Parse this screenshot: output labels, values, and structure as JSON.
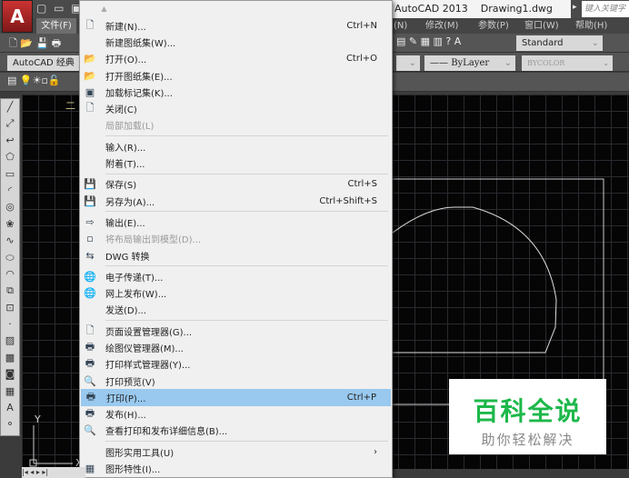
{
  "titlebar": {
    "app_logo": "A",
    "quick_access": "▢ ▭ ▣",
    "title": "AutoCAD 2013",
    "document": "Drawing1.dwg",
    "search_placeholder": "键入关键字"
  },
  "menubar": {
    "file": "文件(F)",
    "partial": "(N)",
    "modify": "修改(M)",
    "params": "参数(P)",
    "window": "窗口(W)",
    "help": "帮助(H)"
  },
  "toolbar": {
    "workspace": "AutoCAD 经典",
    "text_style": "Standard",
    "linetype": "ByLayer",
    "plotstyle": "BYCOLOR",
    "annotation": "二"
  },
  "file_menu": {
    "groups": [
      [
        {
          "icon": "new-icon",
          "glyph": "🗋",
          "label": "新建(N)...",
          "shortcut": "Ctrl+N"
        },
        {
          "icon": "",
          "glyph": "",
          "label": "新建图纸集(W)...",
          "shortcut": ""
        },
        {
          "icon": "open-icon",
          "glyph": "📂",
          "label": "打开(O)...",
          "shortcut": "Ctrl+O"
        },
        {
          "icon": "open-sheetset-icon",
          "glyph": "📂",
          "label": "打开图纸集(E)...",
          "shortcut": ""
        },
        {
          "icon": "markup-icon",
          "glyph": "▣",
          "label": "加载标记集(K)...",
          "shortcut": ""
        },
        {
          "icon": "close-icon",
          "glyph": "🗋",
          "label": "关闭(C)",
          "shortcut": ""
        },
        {
          "icon": "",
          "glyph": "",
          "label": "局部加载(L)",
          "shortcut": "",
          "disabled": true
        }
      ],
      [
        {
          "icon": "",
          "glyph": "",
          "label": "输入(R)...",
          "shortcut": ""
        },
        {
          "icon": "",
          "glyph": "",
          "label": "附着(T)...",
          "shortcut": ""
        }
      ],
      [
        {
          "icon": "save-icon",
          "glyph": "💾",
          "label": "保存(S)",
          "shortcut": "Ctrl+S"
        },
        {
          "icon": "save-as-icon",
          "glyph": "💾",
          "label": "另存为(A)...",
          "shortcut": "Ctrl+Shift+S"
        }
      ],
      [
        {
          "icon": "export-icon",
          "glyph": "⇨",
          "label": "输出(E)...",
          "shortcut": ""
        },
        {
          "icon": "export-layout-icon",
          "glyph": "▫",
          "label": "将布局输出到模型(D)...",
          "shortcut": "",
          "disabled": true
        },
        {
          "icon": "dwg-convert-icon",
          "glyph": "⇆",
          "label": "DWG 转换",
          "shortcut": ""
        }
      ],
      [
        {
          "icon": "etransmit-icon",
          "glyph": "🌐",
          "label": "电子传递(T)...",
          "shortcut": ""
        },
        {
          "icon": "publish-web-icon",
          "glyph": "🌐",
          "label": "网上发布(W)...",
          "shortcut": ""
        },
        {
          "icon": "",
          "glyph": "",
          "label": "发送(D)...",
          "shortcut": ""
        }
      ],
      [
        {
          "icon": "page-setup-icon",
          "glyph": "🗋",
          "label": "页面设置管理器(G)...",
          "shortcut": ""
        },
        {
          "icon": "plotter-manager-icon",
          "glyph": "🖶",
          "label": "绘图仪管理器(M)...",
          "shortcut": ""
        },
        {
          "icon": "plot-style-icon",
          "glyph": "🖶",
          "label": "打印样式管理器(Y)...",
          "shortcut": ""
        },
        {
          "icon": "plot-preview-icon",
          "glyph": "🔍",
          "label": "打印预览(V)",
          "shortcut": ""
        },
        {
          "icon": "plot-icon",
          "glyph": "🖶",
          "label": "打印(P)...",
          "shortcut": "Ctrl+P",
          "highlighted": true
        },
        {
          "icon": "publish-icon",
          "glyph": "🖶",
          "label": "发布(H)...",
          "shortcut": ""
        },
        {
          "icon": "plot-details-icon",
          "glyph": "🔍",
          "label": "查看打印和发布详细信息(B)...",
          "shortcut": ""
        }
      ],
      [
        {
          "icon": "",
          "glyph": "",
          "label": "图形实用工具(U)",
          "shortcut": "›"
        },
        {
          "icon": "drawing-properties-icon",
          "glyph": "▦",
          "label": "图形特性(I)...",
          "shortcut": ""
        }
      ]
    ]
  },
  "draw_tools": [
    "line",
    "construction-line",
    "polyline",
    "polygon",
    "rectangle",
    "arc",
    "circle",
    "revision-cloud",
    "spline",
    "ellipse",
    "ellipse-arc",
    "insert-block",
    "make-block",
    "point",
    "hatch",
    "gradient",
    "region",
    "table",
    "multiline-text",
    "add-selected"
  ],
  "ucs": {
    "y": "Y",
    "x": "X"
  },
  "watermark": {
    "title": "百科全说",
    "subtitle": "助你轻松解决"
  },
  "colors": {
    "highlight": "#99c9ef",
    "watermark_green": "#1db84a"
  }
}
